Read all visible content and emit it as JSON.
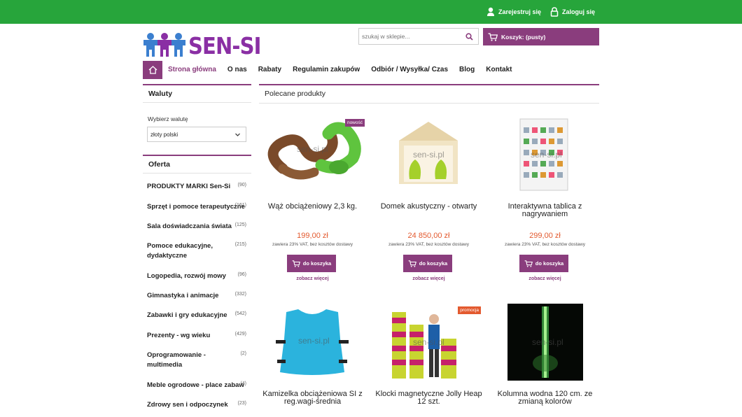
{
  "topbar": {
    "register_label": "Zarejestruj się",
    "login_label": "Zaloguj się"
  },
  "logo": {
    "text": "SEN-SI"
  },
  "search": {
    "placeholder": "szukaj w sklepie..."
  },
  "cart": {
    "label": "Koszyk: (pusty)"
  },
  "nav": {
    "items": [
      {
        "label": "Strona główna"
      },
      {
        "label": "O nas"
      },
      {
        "label": "Rabaty"
      },
      {
        "label": "Regulamin zakupów"
      },
      {
        "label": "Odbiór / Wysyłka/ Czas"
      },
      {
        "label": "Blog"
      },
      {
        "label": "Kontakt"
      }
    ]
  },
  "sidebar": {
    "currency_title": "Waluty",
    "currency_label": "Wybierz walutę",
    "currency_value": "złoty polski",
    "offer_title": "Oferta",
    "categories": [
      {
        "label": "PRODUKTY MARKI Sen-Si",
        "count": "(90)"
      },
      {
        "label": "Sprzęt i pomoce terapeutyczne",
        "count": "(161)"
      },
      {
        "label": "Sala doświadczania świata",
        "count": "(125)"
      },
      {
        "label": "Pomoce edukacyjne, dydaktyczne",
        "count": "(215)"
      },
      {
        "label": "Logopedia, rozwój mowy",
        "count": "(96)"
      },
      {
        "label": "Gimnastyka i animacje",
        "count": "(332)"
      },
      {
        "label": "Zabawki i gry edukacyjne",
        "count": "(542)"
      },
      {
        "label": "Prezenty - wg wieku",
        "count": "(429)"
      },
      {
        "label": "Oprogramowanie - multimedia",
        "count": "(2)"
      },
      {
        "label": "Meble ogrodowe - place zabaw",
        "count": "(4)"
      },
      {
        "label": "Zdrowy sen i odpoczynek",
        "count": "(23)"
      }
    ]
  },
  "main": {
    "title": "Polecane produkty",
    "buy_label": "do koszyka",
    "more_label": "zobacz więcej",
    "watermark": "sen-si.pl",
    "products": [
      {
        "name": "Wąż obciążeniowy 2,3 kg.",
        "price": "199,00 zł",
        "vat": "zawiera 23% VAT, bez kosztów dostawy",
        "badge": "nowość",
        "badge_color": "#8a3d7d"
      },
      {
        "name": "Domek akustyczny - otwarty",
        "price": "24 850,00 zł",
        "vat": "zawiera 23% VAT, bez kosztów dostawy",
        "badge": "",
        "badge_color": ""
      },
      {
        "name": "Interaktywna tablica z nagrywaniem",
        "price": "299,00 zł",
        "vat": "zawiera 23% VAT, bez kosztów dostawy",
        "badge": "",
        "badge_color": ""
      },
      {
        "name": "Kamizelka obciążeniowa SI z reg.wagi-średnia",
        "price": "",
        "vat": "",
        "badge": "",
        "badge_color": ""
      },
      {
        "name": "Klocki magnetyczne Jolly Heap 12 szt.",
        "price": "",
        "vat": "",
        "badge": "promocja",
        "badge_color": "#e35a2f"
      },
      {
        "name": "Kolumna wodna 120 cm. ze zmianą kolorów",
        "price": "",
        "vat": "",
        "badge": "",
        "badge_color": ""
      }
    ]
  },
  "colors": {
    "green": "#27a53b",
    "purple": "#8a3d7d",
    "price": "#e35a2f"
  }
}
